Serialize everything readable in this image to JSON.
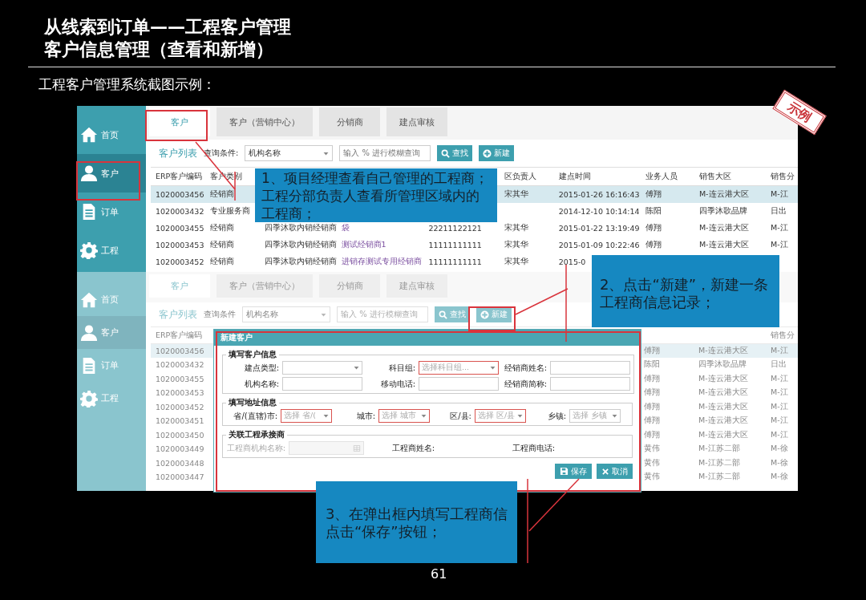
{
  "title_lines": [
    "从线索到订单——工程客户管理",
    "客户信息管理（查看和新增）"
  ],
  "subtitle": "工程客户管理系统截图示例：",
  "stamp": "示例",
  "screens": [
    {
      "dimmed": false,
      "sidebar": [
        {
          "label": "首页",
          "selected": false
        },
        {
          "label": "客户",
          "selected": true
        },
        {
          "label": "订单",
          "selected": false
        },
        {
          "label": "工程",
          "selected": false
        }
      ],
      "tabs": [
        {
          "label": "客户",
          "selected": true
        },
        {
          "label": "客户（营销中心）",
          "selected": false
        },
        {
          "label": "分销商",
          "selected": false
        },
        {
          "label": "建点审核",
          "selected": false
        }
      ],
      "toolbar": {
        "list_title": "客户列表",
        "filter_label": "查询条件:",
        "filter_value": "机构名称",
        "search_placeholder": "输入 % 进行模糊查询",
        "buttons": [
          "查找",
          "新建"
        ]
      },
      "table": {
        "columns": [
          {
            "label": "ERP客户编码",
            "kind": "text"
          },
          {
            "label": "客户类别",
            "kind": "text"
          },
          {
            "kind": "text"
          },
          {
            "kind": "link"
          },
          {
            "kind": "text"
          },
          {
            "label": "区负责人",
            "kind": "text"
          },
          {
            "label": "建点时间",
            "kind": "text"
          },
          {
            "label": "业务人员",
            "kind": "text"
          },
          {
            "label": "销售大区",
            "kind": "text"
          },
          {
            "label": "销售分",
            "kind": "text"
          }
        ],
        "rows": [
          {
            "selected": true,
            "column_1": "1020003456",
            "column_2": "经销商",
            "column_6": "宋其华",
            "column_7": "2015-01-26 16:16:43",
            "column_8": "傅翔",
            "column_9": "M-连云港大区",
            "column_10": "M-江"
          },
          {
            "selected": false,
            "column_1": "1020003432",
            "column_2": "专业服务商",
            "column_7": "2014-12-10 10:14:14",
            "column_8": "陈阳",
            "column_9": "四季沐歌品牌",
            "column_10": "日出"
          },
          {
            "selected": false,
            "column_1": "1020003455",
            "column_2": "经销商",
            "column_3": "四季沐歌内销经销商",
            "column_4": "袋",
            "column_5": "22211122121",
            "column_6": "宋其华",
            "column_7": "2015-01-22 13:19:49",
            "column_8": "傅翔",
            "column_9": "M-连云港大区",
            "column_10": "M-江"
          },
          {
            "selected": false,
            "column_1": "1020003453",
            "column_2": "经销商",
            "column_3": "四季沐歌内销经销商",
            "column_4": "测试经销商1",
            "column_5": "11111111111",
            "column_6": "宋其华",
            "column_7": "2015-01-09 10:22:46",
            "column_8": "傅翔",
            "column_9": "M-连云港大区",
            "column_10": "M-江"
          },
          {
            "selected": false,
            "column_1": "1020003452",
            "column_2": "经销商",
            "column_3": "四季沐歌内销经销商",
            "column_4": "进销存测试专用经销商",
            "column_5": "11111111111",
            "column_6": "宋其华",
            "column_7": "2015-0"
          }
        ]
      }
    },
    {
      "dimmed": true,
      "sidebar": [
        {
          "label": "首页",
          "selected": false
        },
        {
          "label": "客户",
          "selected": true
        },
        {
          "label": "订单",
          "selected": false
        },
        {
          "label": "工程",
          "selected": false
        }
      ],
      "tabs": [
        {
          "label": "客户",
          "selected": true
        },
        {
          "label": "客户（营销中心）",
          "selected": false
        },
        {
          "label": "分销商",
          "selected": false
        },
        {
          "label": "建点审核",
          "selected": false
        }
      ],
      "toolbar": {
        "list_title": "客户列表",
        "filter_label": "查询条件",
        "filter_value": "机构名称",
        "search_placeholder": "输入 % 进行模糊查询",
        "buttons": [
          "查找",
          "新建"
        ]
      },
      "table": {
        "columns": [
          {
            "label": "ERP客户编码",
            "kind": "text"
          },
          {
            "kind": "text"
          },
          {
            "kind": "text"
          },
          {
            "kind": "link"
          },
          {
            "kind": "text"
          },
          {
            "kind": "text"
          },
          {
            "kind": "text"
          },
          {
            "kind": "text"
          },
          {
            "kind": "text"
          },
          {
            "label": "销售分",
            "kind": "text"
          }
        ],
        "rows": [
          {
            "selected": true,
            "column_1": "1020003456",
            "column_8": "傅翔",
            "column_9": "M-连云港大区",
            "column_10": "M-江"
          },
          {
            "selected": false,
            "column_1": "1020003432",
            "column_8": "陈阳",
            "column_9": "四季沐歌品牌",
            "column_10": "日出"
          },
          {
            "selected": false,
            "column_1": "1020003455",
            "column_8": "傅翔",
            "column_9": "M-连云港大区",
            "column_10": "M-江"
          },
          {
            "selected": false,
            "column_1": "1020003453",
            "column_8": "傅翔",
            "column_9": "M-连云港大区",
            "column_10": "M-江"
          },
          {
            "selected": false,
            "column_1": "1020003452",
            "column_8": "傅翔",
            "column_9": "M-连云港大区",
            "column_10": "M-江"
          },
          {
            "selected": false,
            "column_1": "1020003451",
            "column_8": "傅翔",
            "column_9": "M-连云港大区",
            "column_10": "M-江"
          },
          {
            "selected": false,
            "column_1": "1020003450",
            "column_8": "傅翔",
            "column_9": "M-连云港大区",
            "column_10": "M-江"
          },
          {
            "selected": false,
            "column_1": "1020003449",
            "column_8": "黄伟",
            "column_9": "M-江苏二部",
            "column_10": "M-徐"
          },
          {
            "selected": false,
            "column_1": "1020003448",
            "column_8": "黄伟",
            "column_9": "M-江苏二部",
            "column_10": "M-徐"
          },
          {
            "selected": false,
            "column_1": "1020003447",
            "column_8": "黄伟",
            "column_9": "M-江苏二部",
            "column_10": "M-徐"
          }
        ]
      }
    }
  ],
  "dialog": {
    "title": "新建客户",
    "sections": [
      {
        "legend": "填写客户信息",
        "fields": [
          {
            "label": "建点类型:",
            "kind": "select",
            "required": false,
            "disabled": false
          },
          {
            "label": "科目组:",
            "kind": "select",
            "placeholder": "选择科目组...",
            "required": true,
            "disabled": false
          },
          {
            "label": "经销商姓名:",
            "kind": "input",
            "required": false,
            "disabled": false
          },
          {
            "label": "机构名称:",
            "kind": "input",
            "required": false,
            "disabled": false
          },
          {
            "label": "移动电话:",
            "kind": "input",
            "required": false,
            "disabled": false
          },
          {
            "label": "经销商简称:",
            "kind": "input",
            "required": false,
            "disabled": false
          }
        ]
      },
      {
        "legend": "填写地址信息",
        "fields": [
          {
            "label": "省/(直辖)市:",
            "kind": "select",
            "placeholder": "选择 省/(",
            "required": true,
            "disabled": false
          },
          {
            "label": "城市:",
            "kind": "select",
            "placeholder": "选择 城市",
            "required": true,
            "disabled": false
          },
          {
            "label": "区/县:",
            "kind": "select",
            "placeholder": "选择 区/县",
            "required": true,
            "disabled": false
          },
          {
            "label": "乡镇:",
            "kind": "select",
            "placeholder": "选择 乡镇",
            "required": false,
            "disabled": false
          }
        ]
      },
      {
        "legend": "关联工程承接商",
        "fields": [
          {
            "label": "工程商机构名称:",
            "kind": "lookup",
            "required": false,
            "disabled": true
          },
          {
            "label": "工程商姓名:",
            "kind": "label"
          },
          {
            "label": "工程商电话:",
            "kind": "label"
          }
        ]
      }
    ],
    "buttons": [
      "保存",
      "取消"
    ]
  },
  "callouts": [
    {
      "lines": [
        "1、项目经理查看自己管理的工程商；",
        "工程分部负责人查看所管理区域内的",
        "工程商；"
      ]
    },
    {
      "lines": [
        "2、点击“新建”，新建一条",
        "工程商信息记录；"
      ]
    },
    {
      "lines": [
        "3、在弹出框内填写工程商信",
        "点击“保存”按钮；"
      ]
    }
  ],
  "page_number": "61"
}
